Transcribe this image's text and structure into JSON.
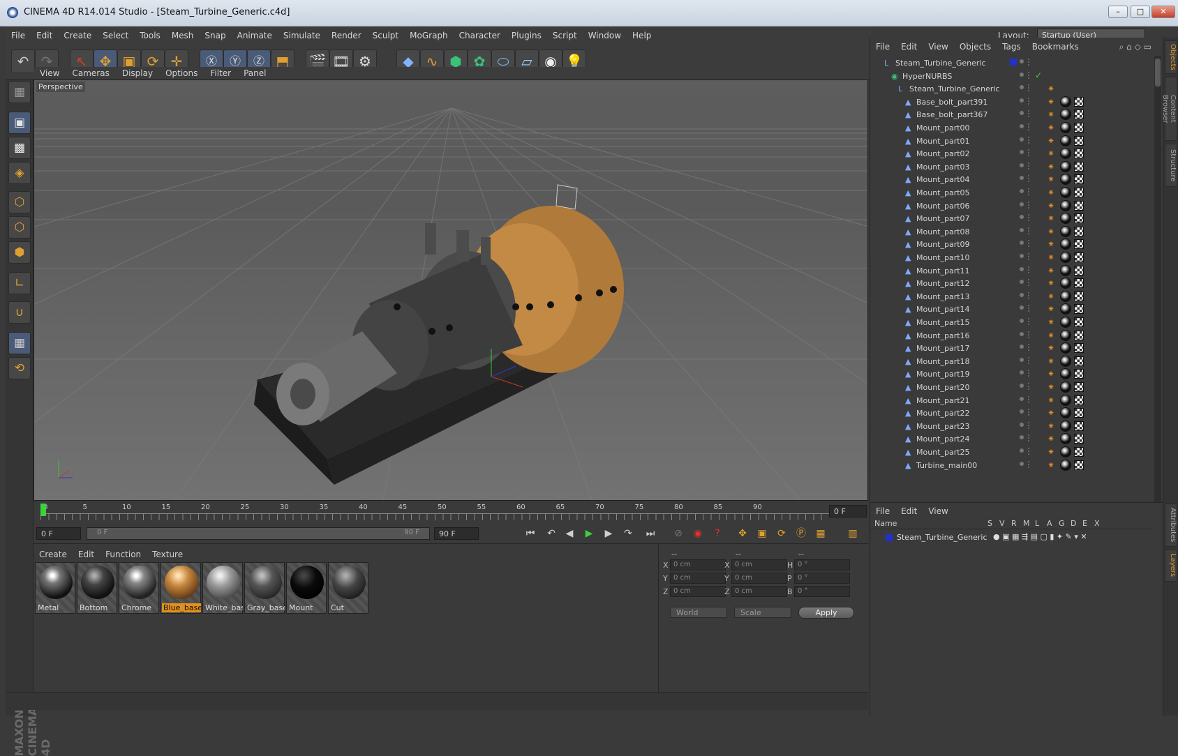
{
  "window": {
    "title": "CINEMA 4D R14.014 Studio - [Steam_Turbine_Generic.c4d]",
    "minimize": "–",
    "maximize": "□",
    "close": "✕"
  },
  "menubar": [
    "File",
    "Edit",
    "Create",
    "Select",
    "Tools",
    "Mesh",
    "Snap",
    "Animate",
    "Simulate",
    "Render",
    "Sculpt",
    "MoGraph",
    "Character",
    "Plugins",
    "Script",
    "Window",
    "Help"
  ],
  "layout": {
    "label": "Layout:",
    "value": "Startup (User)"
  },
  "viewport": {
    "menu": [
      "View",
      "Cameras",
      "Display",
      "Options",
      "Filter",
      "Panel"
    ],
    "label": "Perspective"
  },
  "timeline": {
    "ticks": [
      "0",
      "5",
      "10",
      "15",
      "20",
      "25",
      "30",
      "35",
      "40",
      "45",
      "50",
      "55",
      "60",
      "65",
      "70",
      "75",
      "80",
      "85",
      "90"
    ],
    "current_frame": "0 F"
  },
  "transport": {
    "start_field": "0 F",
    "range_start": "0 F",
    "range_end": "90 F",
    "end_field": "90 F"
  },
  "materials": {
    "menu": [
      "Create",
      "Edit",
      "Function",
      "Texture"
    ],
    "items": [
      {
        "name": "Metal"
      },
      {
        "name": "Bottom"
      },
      {
        "name": "Chrome"
      },
      {
        "name": "Blue_base"
      },
      {
        "name": "White_base"
      },
      {
        "name": "Gray_base"
      },
      {
        "name": "Mount"
      },
      {
        "name": "Cut"
      }
    ]
  },
  "coordinates": {
    "headers": [
      "--",
      "--",
      "--"
    ],
    "rows": [
      {
        "a": "X",
        "av": "0 cm",
        "b": "X",
        "bv": "0 cm",
        "c": "H",
        "cv": "0 °"
      },
      {
        "a": "Y",
        "av": "0 cm",
        "b": "Y",
        "bv": "0 cm",
        "c": "P",
        "cv": "0 °"
      },
      {
        "a": "Z",
        "av": "0 cm",
        "b": "Z",
        "bv": "0 cm",
        "c": "B",
        "cv": "0 °"
      }
    ],
    "mode": "World",
    "scale": "Scale",
    "apply": "Apply"
  },
  "objects": {
    "menu": [
      "File",
      "Edit",
      "View",
      "Objects",
      "Tags",
      "Bookmarks"
    ],
    "tree": [
      {
        "name": "Steam_Turbine_Generic",
        "indent": 0
      },
      {
        "name": "HyperNURBS",
        "indent": 1
      },
      {
        "name": "Steam_Turbine_Generic",
        "indent": 2
      },
      {
        "name": "Base_bolt_part391",
        "indent": 3
      },
      {
        "name": "Base_bolt_part367",
        "indent": 3
      },
      {
        "name": "Mount_part00",
        "indent": 3
      },
      {
        "name": "Mount_part01",
        "indent": 3
      },
      {
        "name": "Mount_part02",
        "indent": 3
      },
      {
        "name": "Mount_part03",
        "indent": 3
      },
      {
        "name": "Mount_part04",
        "indent": 3
      },
      {
        "name": "Mount_part05",
        "indent": 3
      },
      {
        "name": "Mount_part06",
        "indent": 3
      },
      {
        "name": "Mount_part07",
        "indent": 3
      },
      {
        "name": "Mount_part08",
        "indent": 3
      },
      {
        "name": "Mount_part09",
        "indent": 3
      },
      {
        "name": "Mount_part10",
        "indent": 3
      },
      {
        "name": "Mount_part11",
        "indent": 3
      },
      {
        "name": "Mount_part12",
        "indent": 3
      },
      {
        "name": "Mount_part13",
        "indent": 3
      },
      {
        "name": "Mount_part14",
        "indent": 3
      },
      {
        "name": "Mount_part15",
        "indent": 3
      },
      {
        "name": "Mount_part16",
        "indent": 3
      },
      {
        "name": "Mount_part17",
        "indent": 3
      },
      {
        "name": "Mount_part18",
        "indent": 3
      },
      {
        "name": "Mount_part19",
        "indent": 3
      },
      {
        "name": "Mount_part20",
        "indent": 3
      },
      {
        "name": "Mount_part21",
        "indent": 3
      },
      {
        "name": "Mount_part22",
        "indent": 3
      },
      {
        "name": "Mount_part23",
        "indent": 3
      },
      {
        "name": "Mount_part24",
        "indent": 3
      },
      {
        "name": "Mount_part25",
        "indent": 3
      },
      {
        "name": "Turbine_main00",
        "indent": 3
      }
    ]
  },
  "layers": {
    "menu": [
      "File",
      "Edit",
      "View"
    ],
    "columns": [
      "Name",
      "S",
      "V",
      "R",
      "M",
      "L",
      "A",
      "G",
      "D",
      "E",
      "X"
    ],
    "rows": [
      {
        "name": "Steam_Turbine_Generic"
      }
    ]
  },
  "sidetabs": [
    "Objects",
    "Content Browser",
    "Structure",
    "Attributes",
    "Layers"
  ],
  "brand": "MAXON CINEMA 4D"
}
